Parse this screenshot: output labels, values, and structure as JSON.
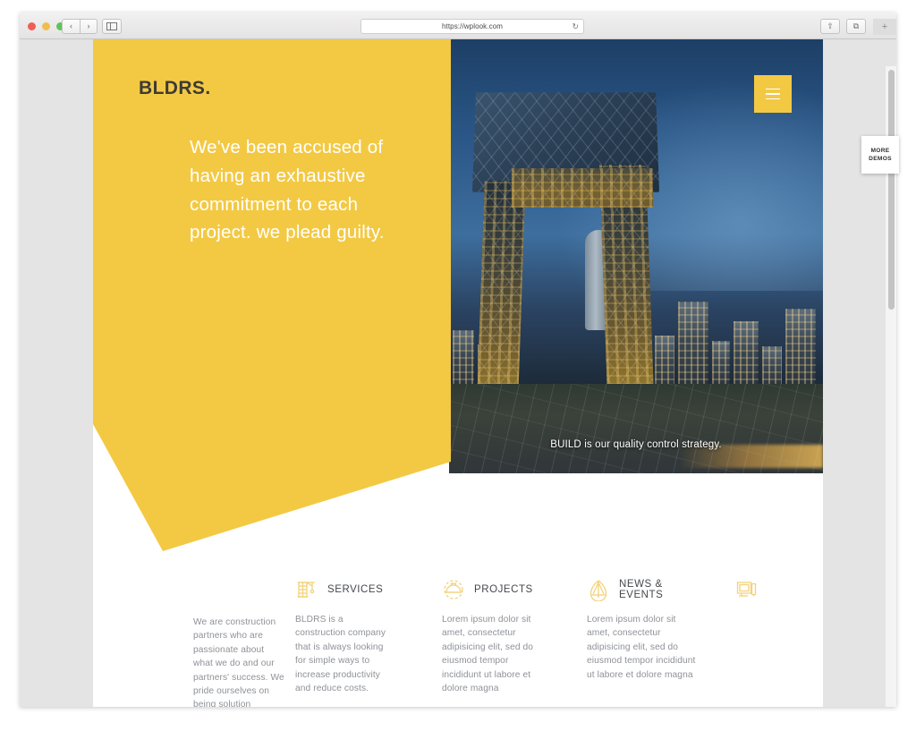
{
  "browser": {
    "url": "https://wplook.com",
    "back_label": "‹",
    "forward_label": "›",
    "reload_label": "↻",
    "sidebar_label": "sidebar",
    "share_label": "⇧",
    "tabs_label": "⧉",
    "newtab_label": "+"
  },
  "site": {
    "logo": "BLDRS.",
    "headline": "We've been accused of having an exhaustive commitment to each project. we plead guilty.",
    "hero_caption": "BUILD is our quality control strategy.",
    "menu_label": "menu"
  },
  "more_demos": {
    "line1": "MORE",
    "line2": "DEMOS"
  },
  "features": [
    {
      "icon": "",
      "title": "",
      "body": "We are construction partners who are passionate about what we do and our partners' success. We pride ourselves on being solution providers."
    },
    {
      "icon": "crane-icon",
      "title": "SERVICES",
      "body": "BLDRS is a construction company that is always looking for simple ways to increase productivity and reduce costs."
    },
    {
      "icon": "hardhat-gear-icon",
      "title": "PROJECTS",
      "body": "Lorem ipsum dolor sit amet, consectetur adipisicing elit, sed do eiusmod tempor incididunt ut labore et dolore magna"
    },
    {
      "icon": "compass-icon",
      "title": "NEWS & EVENTS",
      "body": "Lorem ipsum dolor sit amet, consectetur adipisicing elit, sed do eiusmod tempor incididunt ut labore et dolore magna"
    },
    {
      "icon": "monitor-icon",
      "title": "",
      "body": ""
    }
  ],
  "colors": {
    "brand_yellow": "#f3c944",
    "logo_dark": "#3e3a35",
    "body_text": "#8e9197",
    "heading_text": "#45484d",
    "icon_gold": "#f2d27a"
  }
}
